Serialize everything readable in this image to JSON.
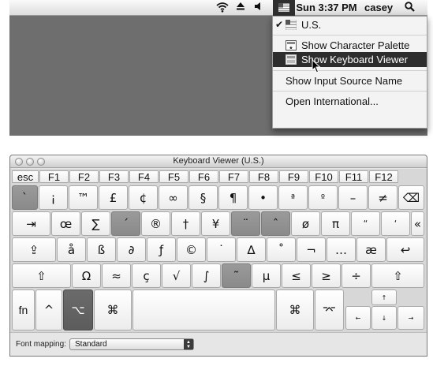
{
  "menubar": {
    "clock": "Sun 3:37 PM",
    "user": "casey",
    "icons": [
      "wifi-icon",
      "eject-icon",
      "volume-icon",
      "us-flag-icon",
      "spotlight-icon"
    ]
  },
  "input_menu": {
    "items": [
      {
        "label": "U.S.",
        "checked": true,
        "icon": "us-flag-icon"
      },
      {
        "label": "Show Character Palette",
        "icon": "character-palette-icon"
      },
      {
        "label": "Show Keyboard Viewer",
        "icon": "keyboard-viewer-icon",
        "highlighted": true
      },
      {
        "label": "Show Input Source Name"
      },
      {
        "label": "Open International..."
      }
    ]
  },
  "keyboard_viewer": {
    "title": "Keyboard Viewer (U.S.)",
    "font_mapping_label": "Font mapping:",
    "font_mapping_value": "Standard",
    "fn_row": [
      "esc",
      "F1",
      "F2",
      "F3",
      "F4",
      "F5",
      "F6",
      "F7",
      "F8",
      "F9",
      "F10",
      "F11",
      "F12"
    ],
    "row1": [
      "`",
      "¡",
      "™",
      "£",
      "¢",
      "∞",
      "§",
      "¶",
      "•",
      "ª",
      "º",
      "–",
      "≠",
      "⌫"
    ],
    "row2": [
      "⇥",
      "œ",
      "∑",
      "´",
      "®",
      "†",
      "¥",
      "¨",
      "ˆ",
      "ø",
      "π",
      "“",
      "‘",
      "«"
    ],
    "row3": [
      "⇪",
      "å",
      "ß",
      "∂",
      "ƒ",
      "©",
      "˙",
      "∆",
      "˚",
      "¬",
      "…",
      "æ",
      "↩"
    ],
    "row4": [
      "⇧",
      "Ω",
      "≈",
      "ç",
      "√",
      "∫",
      "˜",
      "µ",
      "≤",
      "≥",
      "÷",
      "⇧"
    ],
    "row5": [
      "fn",
      "^",
      "⌥",
      "⌘",
      "",
      "⌘",
      "⌤"
    ],
    "arrows": [
      "↑",
      "←",
      "↓",
      "→"
    ],
    "colors": {
      "dead_key": "#8f8f8f",
      "pressed_key": "#616161",
      "menu_highlight": "#2d2d2d"
    }
  }
}
